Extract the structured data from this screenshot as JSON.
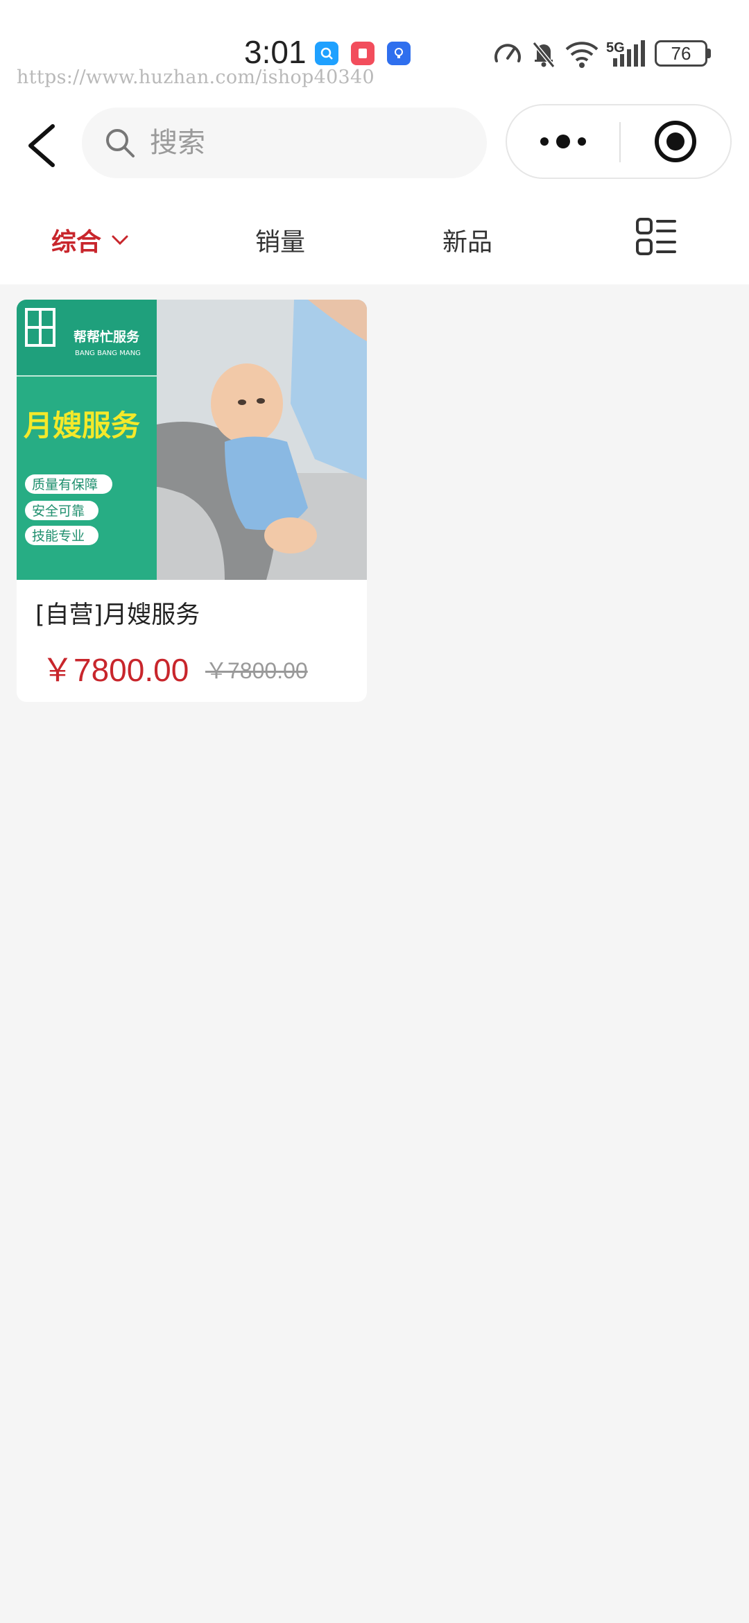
{
  "status_bar": {
    "time": "3:01",
    "network": "5G",
    "battery": "76",
    "icons": [
      "search-app-icon",
      "red-app-icon",
      "bulb-app-icon",
      "speed-icon",
      "mute-bell-icon",
      "wifi-icon",
      "signal-icon"
    ]
  },
  "watermark": "https://www.huzhan.com/ishop40340",
  "nav": {
    "search_placeholder": "搜索"
  },
  "tabs": [
    {
      "label": "综合",
      "active": true
    },
    {
      "label": "销量",
      "active": false
    },
    {
      "label": "新品",
      "active": false
    }
  ],
  "products": [
    {
      "title": "[自营]月嫂服务",
      "price": "￥7800.00",
      "original_price": "￥7800.00",
      "image": {
        "brand_cn": "帮帮忙服务",
        "brand_en": "BANG BANG MANG",
        "headline": "月嫂服务",
        "tags": [
          "质量有保障",
          "安全可靠",
          "技能专业"
        ]
      }
    }
  ],
  "colors": {
    "accent": "#c8262c",
    "banner_green": "#1fa07c",
    "headline_yellow": "#f4e92a",
    "page_bg": "#f5f5f5"
  }
}
